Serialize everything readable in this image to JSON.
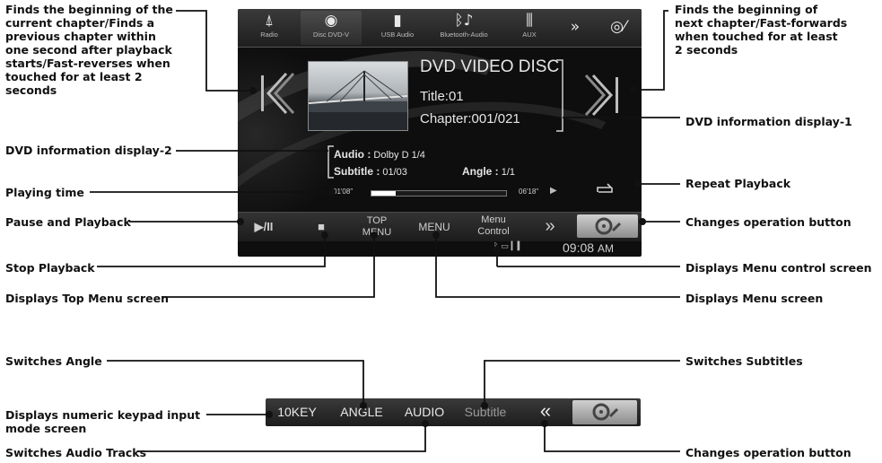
{
  "callouts": {
    "prev_chapter": [
      "Finds the beginning of the",
      "current chapter/Finds a",
      "previous chapter within",
      "one second after playback",
      "starts/Fast-reverses when",
      "touched for at least 2",
      "seconds"
    ],
    "next_chapter": [
      "Finds the beginning of",
      "next chapter/Fast-forwards",
      "when touched for at least",
      "2 seconds"
    ],
    "dvd_info_1": "DVD information display-1",
    "dvd_info_2": "DVD information display-2",
    "playing_time": "Playing time",
    "repeat_playback": "Repeat Playback",
    "pause_playback": "Pause and Playback",
    "changes_op_1": "Changes operation button",
    "stop_playback": "Stop Playback",
    "menu_control_screen": "Displays Menu control screen",
    "top_menu_screen": "Displays Top Menu screen",
    "menu_screen": "Displays Menu screen",
    "switches_angle": "Switches Angle",
    "switches_subtitles": "Switches Subtitles",
    "numeric_keypad": [
      "Displays numeric keypad input",
      "mode screen"
    ],
    "switches_audio": "Switches Audio Tracks",
    "changes_op_2": "Changes operation button"
  },
  "screen": {
    "sources": [
      {
        "label": "Radio",
        "icon": "antenna-icon"
      },
      {
        "label": "Disc DVD-V",
        "icon": "disc-icon"
      },
      {
        "label": "USB Audio",
        "icon": "usb-icon"
      },
      {
        "label": "Bluetooth-Audio",
        "icon": "bluetooth-music-icon"
      },
      {
        "label": "AUX",
        "icon": "aux-icon"
      }
    ],
    "more_icon": "double-chevron-right-icon",
    "settings_icon": "wrench-disc-icon",
    "disc_title": "DVD VIDEO DISC",
    "title": "Title:01",
    "chapter": "Chapter:001/021",
    "audio_label": "Audio :",
    "audio_value": "Dolby D 1/4",
    "subtitle_label": "Subtitle :",
    "subtitle_value": "01/03",
    "angle_label": "Angle :",
    "angle_value": "1/1",
    "elapsed": "01'08\"",
    "total": "06'18\"",
    "progress": 0.18,
    "buttons": {
      "pause_play": "▶/II",
      "stop": "■",
      "top_menu": [
        "TOP",
        "MENU"
      ],
      "menu": "MENU",
      "menu_control": [
        "Menu",
        "Control"
      ],
      "changes": "»"
    },
    "clock": "09:08",
    "clock_suffix": "AM"
  },
  "strip": {
    "buttons": [
      "10KEY",
      "ANGLE",
      "AUDIO",
      "Subtitle"
    ],
    "back": "«"
  },
  "colors": {
    "screen_bg": "#0e0e0e",
    "bar_bg": "#2a2a2a",
    "text": "#e6e6e6",
    "callout": "#111111"
  }
}
